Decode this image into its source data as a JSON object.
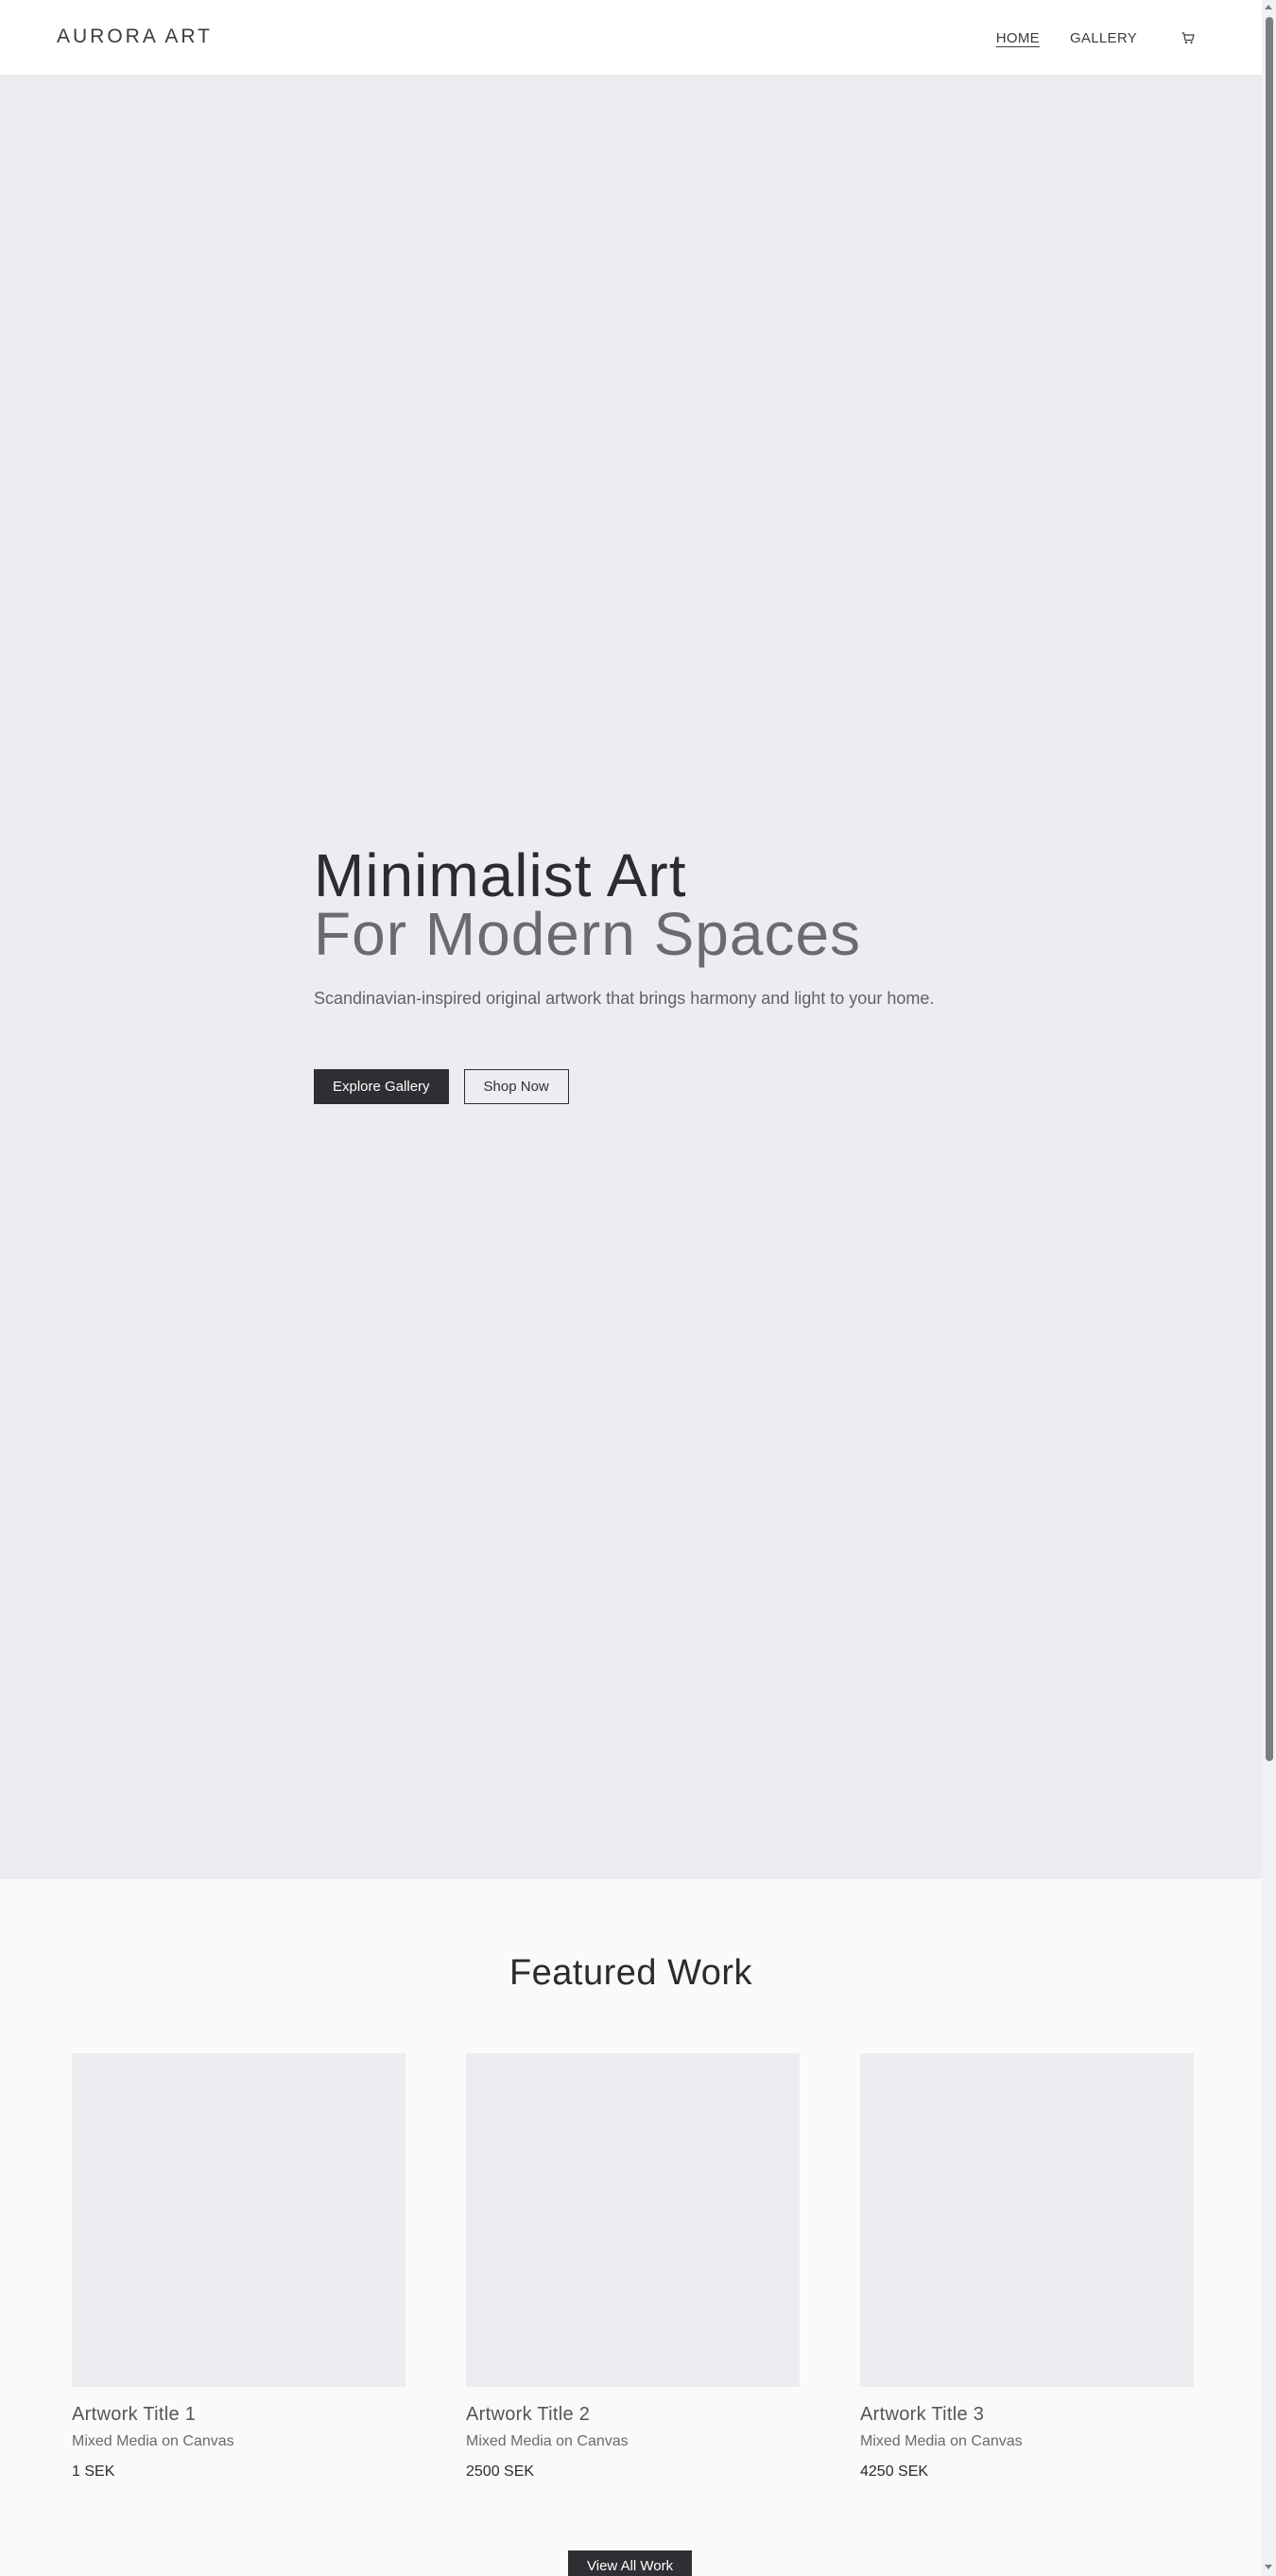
{
  "header": {
    "brand": "AURORA ART",
    "nav": [
      {
        "label": "HOME",
        "active": true
      },
      {
        "label": "GALLERY",
        "active": false
      }
    ],
    "cart_icon": "cart-icon"
  },
  "hero": {
    "title_line1": "Minimalist Art",
    "title_line2": "For Modern Spaces",
    "subtitle": "Scandinavian-inspired original artwork that brings harmony and light to your home.",
    "primary_button": "Explore Gallery",
    "secondary_button": "Shop Now",
    "background": "#ededf1"
  },
  "featured": {
    "title": "Featured Work",
    "items": [
      {
        "title": "Artwork Title 1",
        "medium": "Mixed Media on Canvas",
        "price": "1 SEK"
      },
      {
        "title": "Artwork Title 2",
        "medium": "Mixed Media on Canvas",
        "price": "2500 SEK"
      },
      {
        "title": "Artwork Title 3",
        "medium": "Mixed Media on Canvas",
        "price": "4250 SEK"
      }
    ],
    "view_all_button": "View All Work"
  },
  "colors": {
    "primary_dark": "#2f2f33",
    "muted_text": "#6a6a70",
    "placeholder": "#ededf1"
  }
}
